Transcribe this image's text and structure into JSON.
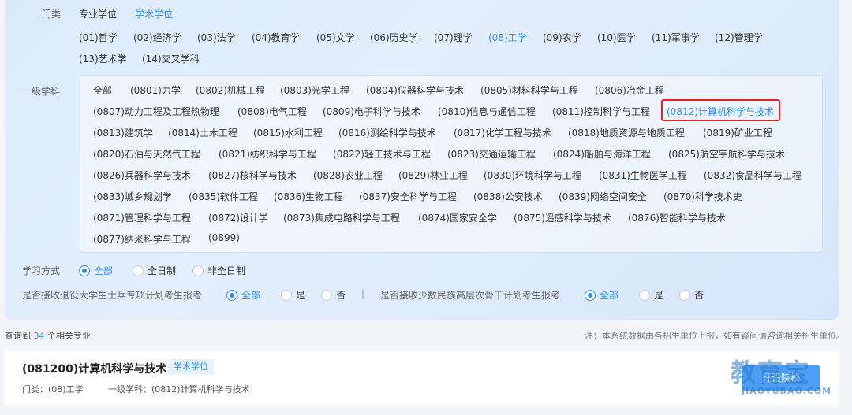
{
  "filters": {
    "category_label": "门类",
    "degree_types": [
      "专业学位",
      "学术学位"
    ],
    "categories_row1": [
      "(01)哲学",
      "(02)经济学",
      "(03)法学",
      "(04)教育学",
      "(05)文学",
      "(06)历史学",
      "(07)理学",
      "(08)工学",
      "(09)农学",
      "(10)医学",
      "(11)军事学",
      "(12)管理学"
    ],
    "categories_row2": [
      "(13)艺术学",
      "(14)交叉学科"
    ],
    "subject_label": "一级学科",
    "subjects": [
      [
        "全部",
        "(0801)力学",
        "(0802)机械工程",
        "(0803)光学工程",
        "(0804)仪器科学与技术",
        "(0805)材料科学与工程",
        "(0806)冶金工程"
      ],
      [
        "(0807)动力工程及工程热物理",
        "(0808)电气工程",
        "(0809)电子科学与技术",
        "(0810)信息与通信工程",
        "(0811)控制科学与工程",
        "(0812)计算机科学与技术"
      ],
      [
        "(0813)建筑学",
        "(0814)土木工程",
        "(0815)水利工程",
        "(0816)测绘科学与技术",
        "(0817)化学工程与技术",
        "(0818)地质资源与地质工程",
        "(0819)矿业工程"
      ],
      [
        "(0820)石油与天然气工程",
        "(0821)纺织科学与工程",
        "(0822)轻工技术与工程",
        "(0823)交通运输工程",
        "(0824)船舶与海洋工程",
        "(0825)航空宇航科学与技术"
      ],
      [
        "(0826)兵器科学与技术",
        "(0827)核科学与技术",
        "(0828)农业工程",
        "(0829)林业工程",
        "(0830)环境科学与工程",
        "(0831)生物医学工程",
        "(0832)食品科学与工程"
      ],
      [
        "(0833)城乡规划学",
        "(0835)软件工程",
        "(0836)生物工程",
        "(0837)安全科学与工程",
        "(0838)公安技术",
        "(0839)网络空间安全",
        "(0870)科学技术史"
      ],
      [
        "(0871)管理科学与工程",
        "(0872)设计学",
        "(0873)集成电路科学与工程",
        "(0874)国家安全学",
        "(0875)遥感科学与技术",
        "(0876)智能科学与技术"
      ],
      [
        "(0877)纳米科学与工程",
        "(0899)"
      ]
    ],
    "study_mode_label": "学习方式",
    "study_modes": [
      "全部",
      "全日制",
      "非全日制"
    ],
    "veteran_label": "是否接收退役大学生士兵专项计划考生报考",
    "veteran_options": [
      "全部",
      "是",
      "否"
    ],
    "separator": "|",
    "minority_label": "是否接收少数民族高层次骨干计划考生报考",
    "minority_options": [
      "全部",
      "是",
      "否"
    ]
  },
  "results": {
    "prefix": "查询到",
    "count": "34",
    "suffix": "个相关专业",
    "note": "注：本系统数据由各招生单位上报，如有疑问请咨询相关招生单位。"
  },
  "card": {
    "title": "(081200)计算机科学与技术",
    "tag": "学术学位",
    "category": "门类：(08)工学",
    "subject": "一级学科：(0812)计算机科学与技术",
    "button": "开设院校"
  },
  "watermark": {
    "big": "教育宝",
    "small": "JIAOYUBAO.COM"
  },
  "colors": {
    "accent": "#2f8df3",
    "highlight": "#e02424"
  }
}
